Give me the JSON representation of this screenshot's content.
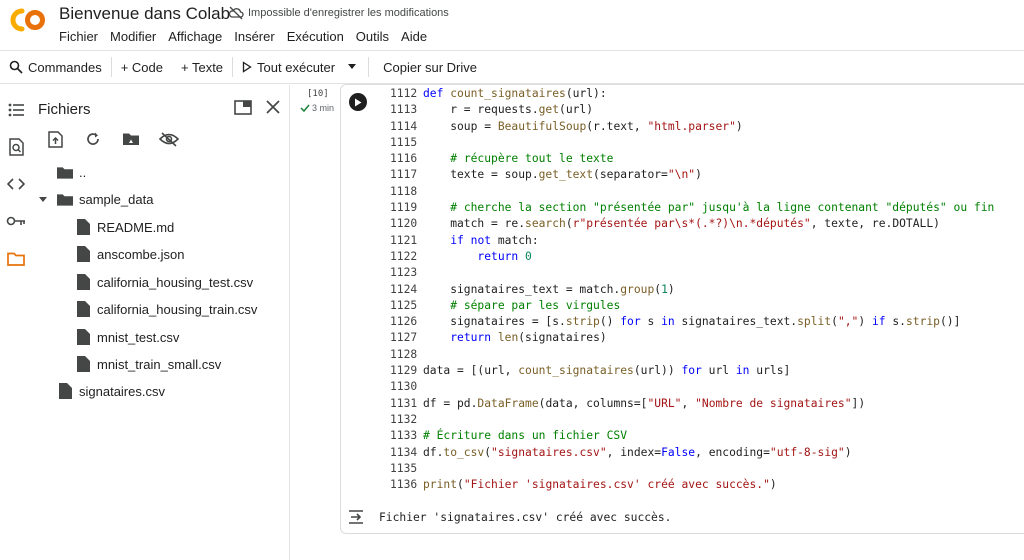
{
  "app": {
    "title": "Bienvenue dans Colab",
    "save_status": "Impossible d'enregistrer les modifications",
    "brand_color": "#F9AB00",
    "brand_color_2": "#E8710A"
  },
  "menu": [
    "Fichier",
    "Modifier",
    "Affichage",
    "Insérer",
    "Exécution",
    "Outils",
    "Aide"
  ],
  "toolbar": {
    "commands": "Commandes",
    "add_code": "+ Code",
    "add_text": "+ Texte",
    "run_all": "Tout exécuter",
    "copy_drive": "Copier sur Drive"
  },
  "files_panel": {
    "title": "Fichiers",
    "tree": [
      {
        "name": "..",
        "type": "folder"
      },
      {
        "name": "sample_data",
        "type": "folder-open"
      },
      {
        "name": "README.md",
        "type": "file"
      },
      {
        "name": "anscombe.json",
        "type": "file"
      },
      {
        "name": "california_housing_test.csv",
        "type": "file"
      },
      {
        "name": "california_housing_train.csv",
        "type": "file"
      },
      {
        "name": "mnist_test.csv",
        "type": "file"
      },
      {
        "name": "mnist_train_small.csv",
        "type": "file"
      },
      {
        "name": "signataires.csv",
        "type": "file"
      }
    ]
  },
  "cell": {
    "exec_count": "[10]",
    "exec_time": "3 min",
    "output": "Fichier 'signataires.csv' créé avec succès.",
    "lines": [
      {
        "n": "1112",
        "code": "def count_signataires(url):"
      },
      {
        "n": "1113",
        "code": "    r = requests.get(url)"
      },
      {
        "n": "1114",
        "code": "    soup = BeautifulSoup(r.text, \"html.parser\")"
      },
      {
        "n": "1115",
        "code": ""
      },
      {
        "n": "1116",
        "code": "    # récupère tout le texte"
      },
      {
        "n": "1117",
        "code": "    texte = soup.get_text(separator=\"\\n\")"
      },
      {
        "n": "1118",
        "code": ""
      },
      {
        "n": "1119",
        "code": "    # cherche la section \"présentée par\" jusqu'à la ligne contenant \"députés\" ou fin"
      },
      {
        "n": "1120",
        "code": "    match = re.search(r\"présentée par\\s*(.*?)\\n.*députés\", texte, re.DOTALL)"
      },
      {
        "n": "1121",
        "code": "    if not match:"
      },
      {
        "n": "1122",
        "code": "        return 0"
      },
      {
        "n": "1123",
        "code": ""
      },
      {
        "n": "1124",
        "code": "    signataires_text = match.group(1)"
      },
      {
        "n": "1125",
        "code": "    # sépare par les virgules"
      },
      {
        "n": "1126",
        "code": "    signataires = [s.strip() for s in signataires_text.split(\",\") if s.strip()]"
      },
      {
        "n": "1127",
        "code": "    return len(signataires)"
      },
      {
        "n": "1128",
        "code": ""
      },
      {
        "n": "1129",
        "code": "data = [(url, count_signataires(url)) for url in urls]"
      },
      {
        "n": "1130",
        "code": ""
      },
      {
        "n": "1131",
        "code": "df = pd.DataFrame(data, columns=[\"URL\", \"Nombre de signataires\"])"
      },
      {
        "n": "1132",
        "code": ""
      },
      {
        "n": "1133",
        "code": "# Écriture dans un fichier CSV"
      },
      {
        "n": "1134",
        "code": "df.to_csv(\"signataires.csv\", index=False, encoding=\"utf-8-sig\")"
      },
      {
        "n": "1135",
        "code": ""
      },
      {
        "n": "1136",
        "code": "print(\"Fichier 'signataires.csv' créé avec succès.\")"
      }
    ]
  }
}
